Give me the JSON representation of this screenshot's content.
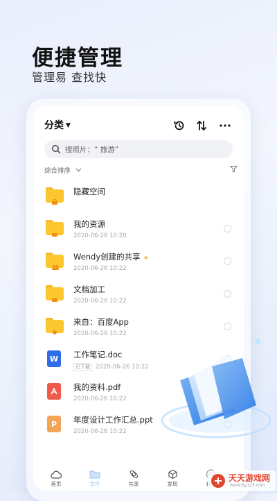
{
  "promo": {
    "title": "便捷管理",
    "subtitle": "管理易 查找快"
  },
  "header": {
    "category_label": "分类",
    "history_icon": "history-icon",
    "sort_icon": "sort-arrows-icon",
    "more_icon": "more-icon"
  },
  "search": {
    "placeholder": "搜照片：“ 旅游”"
  },
  "sortbar": {
    "label": "综合排序"
  },
  "files": [
    {
      "name": "隐藏空间",
      "meta": "",
      "type": "folder-lock"
    },
    {
      "name": "我的资源",
      "meta": "2020-06-26  10:20",
      "type": "folder"
    },
    {
      "name": "Wendy创建的共享",
      "meta": "2020-06-26  10:22",
      "type": "folder-shared",
      "starred": true
    },
    {
      "name": "文档加工",
      "meta": "2020-06-26  10:22",
      "type": "folder"
    },
    {
      "name": "来自：百度App",
      "meta": "2020-06-26  10:22",
      "type": "folder-app"
    },
    {
      "name": "工作笔记.doc",
      "tag": "已下载",
      "meta": "2020-06-26  10:22",
      "type": "word"
    },
    {
      "name": "我的资料.pdf",
      "meta": "2020-06-26  10:22",
      "type": "pdf"
    },
    {
      "name": "年度设计工作汇总.ppt",
      "meta": "2020-06-26  10:22",
      "type": "ppt"
    }
  ],
  "tabbar": {
    "items": [
      {
        "label": "首页",
        "icon": "cloud-icon"
      },
      {
        "label": "文件",
        "icon": "folder-icon",
        "active": true
      },
      {
        "label": "共享",
        "icon": "share-icon"
      },
      {
        "label": "发现",
        "icon": "cube-icon"
      },
      {
        "label": "我的",
        "icon": "profile-cloud-icon"
      }
    ]
  },
  "watermark": {
    "text": "天天游戏网",
    "url": "www.tty123.com"
  },
  "colors": {
    "folder": "#fcc62f",
    "word": "#2f6ee8",
    "pdf": "#ef5a4a",
    "ppt": "#f2a457",
    "accent": "#9cc6ec"
  }
}
